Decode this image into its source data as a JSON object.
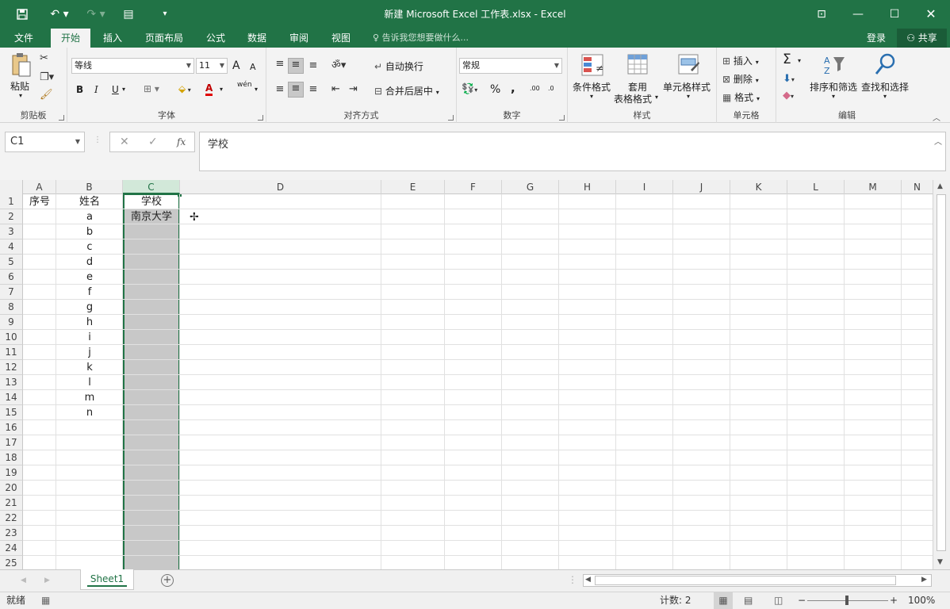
{
  "titlebar": {
    "title": "新建 Microsoft Excel 工作表.xlsx - Excel",
    "save_icon": "save-icon",
    "undo_icon": "undo-icon",
    "redo_icon": "redo-icon"
  },
  "ribbon_tabs": [
    "文件",
    "开始",
    "插入",
    "页面布局",
    "公式",
    "数据",
    "审阅",
    "视图"
  ],
  "active_tab": "开始",
  "tell_me": "告诉我您想要做什么...",
  "account": {
    "login": "登录",
    "share": "共享"
  },
  "ribbon": {
    "clipboard": {
      "label": "剪贴板",
      "paste": "粘贴"
    },
    "font": {
      "label": "字体",
      "font_name": "等线",
      "font_size": "11",
      "bold": "B",
      "italic": "I",
      "underline": "U",
      "grow": "A",
      "shrink": "A",
      "font_color": "A",
      "wen": "wén"
    },
    "alignment": {
      "label": "对齐方式",
      "wrap": "自动换行",
      "merge": "合并后居中"
    },
    "number": {
      "label": "数字",
      "format": "常规",
      "percent": "%",
      "comma": ",",
      "inc_decimal": ".00",
      "dec_decimal": ".0"
    },
    "styles": {
      "label": "样式",
      "conditional": "条件格式",
      "table_line1": "套用",
      "table_line2": "表格格式",
      "cell_styles": "单元格样式"
    },
    "cells": {
      "label": "单元格",
      "insert": "插入",
      "delete": "删除",
      "format": "格式"
    },
    "editing": {
      "label": "编辑",
      "sum": "Σ",
      "sort": "排序和筛选",
      "find": "查找和选择"
    }
  },
  "formula_bar": {
    "name_box": "C1",
    "content": "学校",
    "fx": "fx"
  },
  "columns": [
    "A",
    "B",
    "C",
    "D",
    "E",
    "F",
    "G",
    "H",
    "I",
    "J",
    "K",
    "L",
    "M",
    "N"
  ],
  "selected_column": "C",
  "rows": [
    "1",
    "2",
    "3",
    "4",
    "5",
    "6",
    "7",
    "8",
    "9",
    "10",
    "11",
    "12",
    "13",
    "14",
    "15",
    "16",
    "17",
    "18",
    "19",
    "20",
    "21",
    "22",
    "23",
    "24",
    "25"
  ],
  "cells": {
    "A1": "序号",
    "B1": "姓名",
    "C1": "学校",
    "C2": "南京大学",
    "B2": "a",
    "B3": "b",
    "B4": "c",
    "B5": "d",
    "B6": "e",
    "B7": "f",
    "B8": "g",
    "B9": "h",
    "B10": "i",
    "B11": "j",
    "B12": "k",
    "B13": "l",
    "B14": "m",
    "B15": "n"
  },
  "sheets": [
    "Sheet1"
  ],
  "statusbar": {
    "ready": "就绪",
    "count": "计数: 2",
    "zoom": "100%"
  }
}
